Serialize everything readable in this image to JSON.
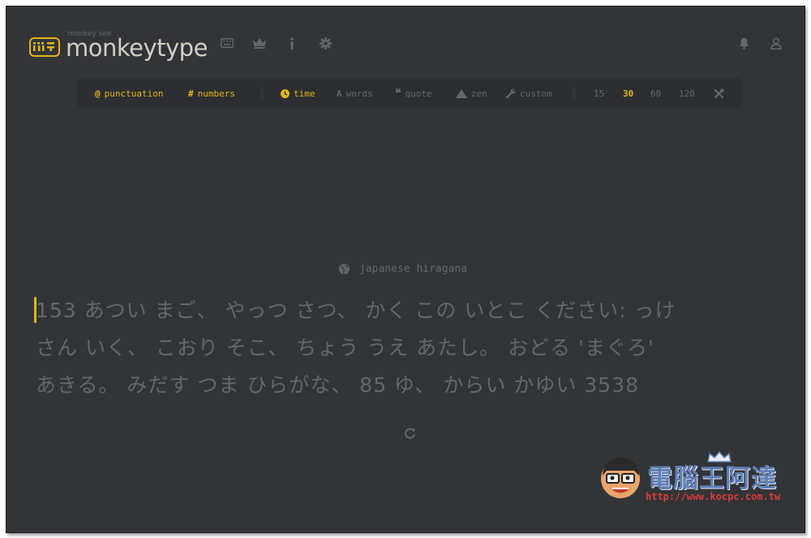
{
  "header": {
    "logo_subtitle": "monkey see",
    "logo_title": "monkeytype",
    "nav_icons": [
      "keyboard-icon",
      "crown-icon",
      "info-icon",
      "gear-icon"
    ],
    "right_icons": [
      "bell-icon",
      "user-icon"
    ]
  },
  "config_bar": {
    "punctuation": "punctuation",
    "numbers": "numbers",
    "time": "time",
    "words": "words",
    "quote": "quote",
    "zen": "zen",
    "custom": "custom",
    "durations": [
      "15",
      "30",
      "60",
      "120"
    ],
    "selected_duration": "30",
    "active": [
      "punctuation",
      "numbers",
      "time",
      "30"
    ]
  },
  "test": {
    "language": "japanese hiragana",
    "lines": [
      "153 あつい まご、 やっつ さつ、 かく この いとこ ください: っけ",
      "さん いく、 こおり そこ、 ちょう うえ あたし。 おどる 'まぐろ'",
      "あきる。 みだす つま ひらがな、 85 ゆ、 からい かゆい 3538"
    ]
  },
  "watermark": {
    "text": "電腦王阿達",
    "url": "http://www.kocpc.com.tw"
  },
  "colors": {
    "background": "#323437",
    "accent": "#e2b714",
    "sub": "#646669",
    "text": "#d1d0c5",
    "sub_alt": "#2c2e31"
  }
}
